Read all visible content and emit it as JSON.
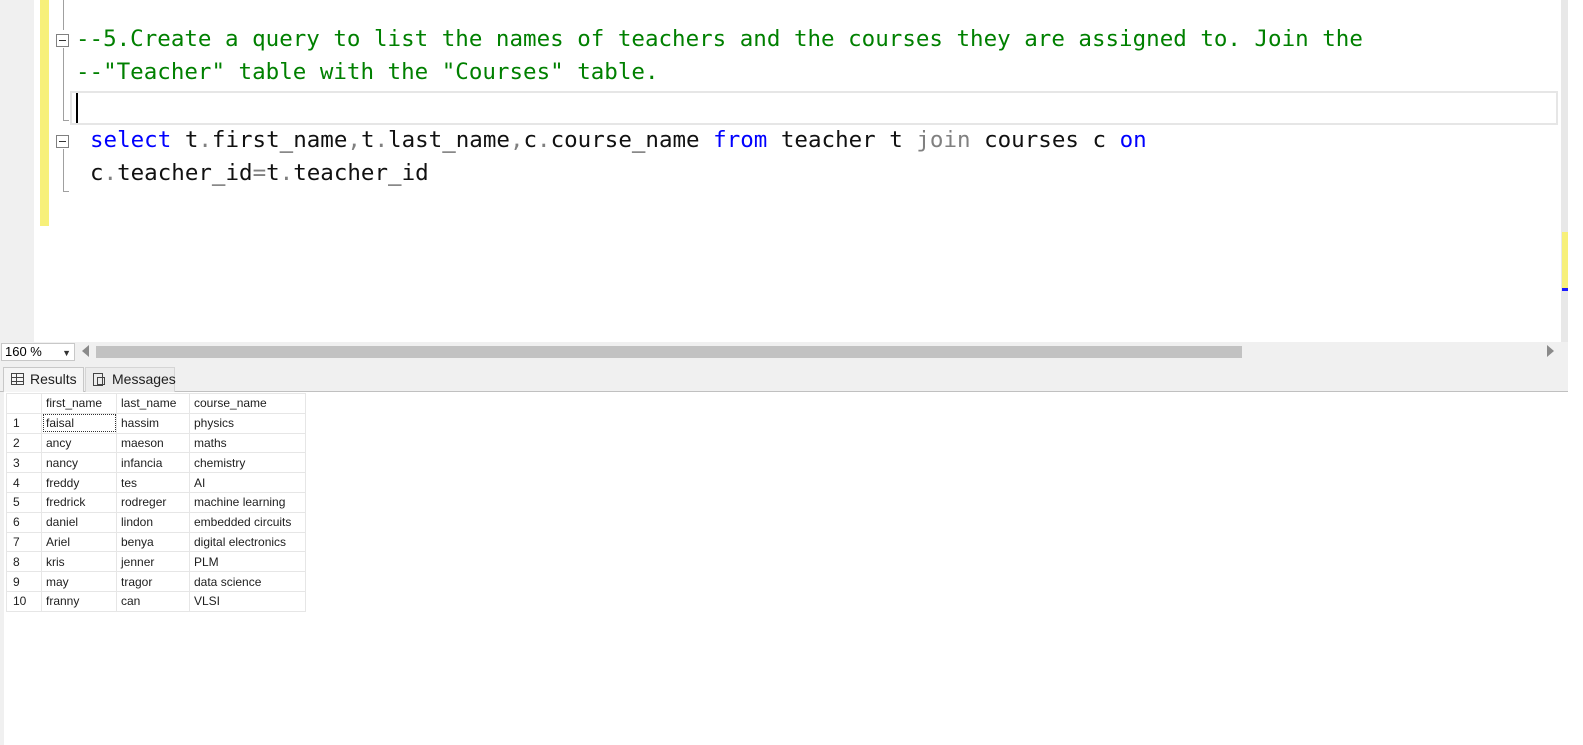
{
  "editor": {
    "comment_line_1": "--5.Create a query to list the names of teachers and the courses they are assigned to. Join the",
    "comment_line_2": "--\"Teacher\" table with the \"Courses\" table.",
    "sql_tokens_line_1": [
      {
        "text": "select",
        "kind": "kw"
      },
      {
        "text": " t",
        "kind": "id"
      },
      {
        "text": ".",
        "kind": "gray"
      },
      {
        "text": "first_name",
        "kind": "id"
      },
      {
        "text": ",",
        "kind": "gray"
      },
      {
        "text": "t",
        "kind": "id"
      },
      {
        "text": ".",
        "kind": "gray"
      },
      {
        "text": "last_name",
        "kind": "id"
      },
      {
        "text": ",",
        "kind": "gray"
      },
      {
        "text": "c",
        "kind": "id"
      },
      {
        "text": ".",
        "kind": "gray"
      },
      {
        "text": "course_name ",
        "kind": "id"
      },
      {
        "text": "from",
        "kind": "kw"
      },
      {
        "text": " teacher t ",
        "kind": "id"
      },
      {
        "text": "join",
        "kind": "gray"
      },
      {
        "text": " courses c ",
        "kind": "id"
      },
      {
        "text": "on",
        "kind": "kw"
      }
    ],
    "sql_tokens_line_2": [
      {
        "text": "c",
        "kind": "id"
      },
      {
        "text": ".",
        "kind": "gray"
      },
      {
        "text": "teacher_id",
        "kind": "id"
      },
      {
        "text": "=",
        "kind": "gray"
      },
      {
        "text": "t",
        "kind": "id"
      },
      {
        "text": ".",
        "kind": "gray"
      },
      {
        "text": "teacher_id",
        "kind": "id"
      }
    ],
    "colors": {
      "comment": "#008000",
      "keyword": "#0000ff",
      "operator": "#808080",
      "change_bar": "#f7f07a"
    }
  },
  "zoom": {
    "value": "160 %"
  },
  "tabs": [
    {
      "label": "Results",
      "icon": "grid-icon",
      "active": true
    },
    {
      "label": "Messages",
      "icon": "messages-icon",
      "active": false
    }
  ],
  "results": {
    "columns": [
      "first_name",
      "last_name",
      "course_name"
    ],
    "rows": [
      [
        "1",
        "faisal",
        "hassim",
        "physics"
      ],
      [
        "2",
        "ancy",
        "maeson",
        "maths"
      ],
      [
        "3",
        "nancy",
        "infancia",
        "chemistry"
      ],
      [
        "4",
        "freddy",
        "tes",
        "AI"
      ],
      [
        "5",
        "fredrick",
        "rodreger",
        "machine learning"
      ],
      [
        "6",
        "daniel",
        "lindon",
        "embedded circuits"
      ],
      [
        "7",
        "Ariel",
        "benya",
        "digital electronics"
      ],
      [
        "8",
        "kris",
        "jenner",
        "PLM"
      ],
      [
        "9",
        "may",
        "tragor",
        "data science"
      ],
      [
        "10",
        "franny",
        "can",
        "VLSI"
      ]
    ]
  }
}
